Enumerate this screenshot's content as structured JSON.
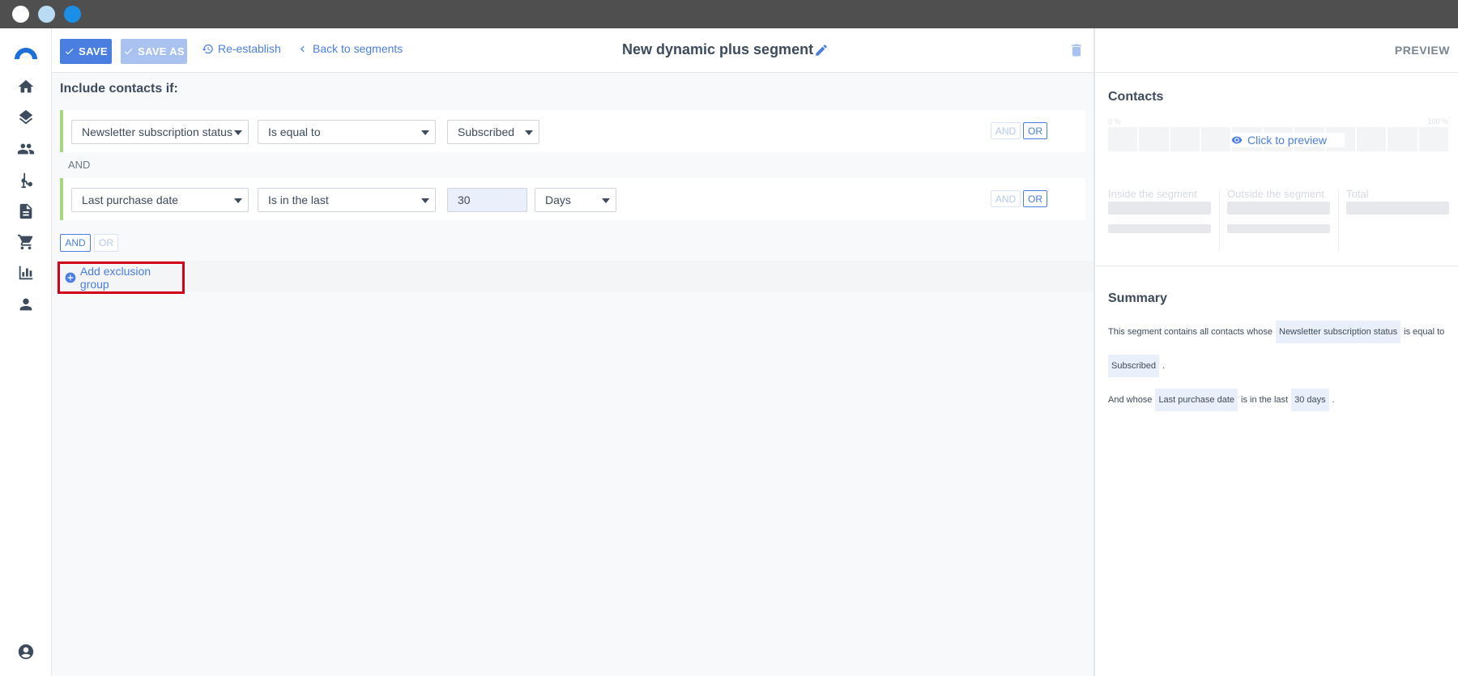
{
  "toolbar": {
    "save_label": "SAVE",
    "save_as_label": "SAVE AS",
    "reestablish_label": "Re-establish",
    "back_label": "Back to segments",
    "title": "New dynamic plus segment"
  },
  "builder": {
    "heading": "Include contacts if:",
    "conditions": [
      {
        "field": "Newsletter subscription status",
        "operator": "Is equal to",
        "value": "Subscribed"
      },
      {
        "field": "Last purchase date",
        "operator": "Is in the last",
        "value": "30",
        "unit": "Days"
      }
    ],
    "separator": "AND",
    "and_label": "AND",
    "or_label": "OR",
    "add_exclusion_label": "Add exclusion group"
  },
  "preview": {
    "title": "PREVIEW",
    "contacts_title": "Contacts",
    "pct_min": "0 %",
    "pct_max": "100 %",
    "click_label": "Click to preview",
    "inside_label": "Inside the segment",
    "outside_label": "Outside the segment",
    "total_label": "Total",
    "summary_title": "Summary",
    "summary": {
      "intro": "This segment contains all contacts whose",
      "field1": "Newsletter subscription status",
      "op1": "is equal to",
      "value1": "Subscribed",
      "dot": ".",
      "and_whose": "And whose",
      "field2": "Last purchase date",
      "op2": "is in the last",
      "value2": "30 days"
    }
  },
  "colors": {
    "accent": "#4a7ee0",
    "condition_border": "#a8d67e",
    "highlight": "#d0021b"
  }
}
